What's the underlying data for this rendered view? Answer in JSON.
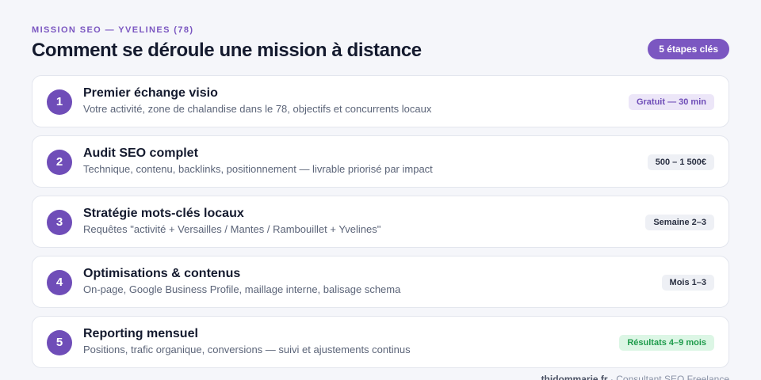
{
  "header": {
    "eyebrow": "MISSION SEO — YVELINES (78)",
    "title": "Comment se déroule une mission à distance",
    "steps_badge": "5 étapes clés"
  },
  "steps": [
    {
      "number": "1",
      "title": "Premier échange visio",
      "description": "Votre activité, zone de chalandise dans le 78, objectifs et concurrents locaux",
      "badge": "Gratuit — 30 min",
      "badge_style": "purple"
    },
    {
      "number": "2",
      "title": "Audit SEO complet",
      "description": "Technique, contenu, backlinks, positionnement — livrable priorisé par impact",
      "badge": "500 – 1 500€",
      "badge_style": "gray"
    },
    {
      "number": "3",
      "title": "Stratégie mots-clés locaux",
      "description": "Requêtes \"activité + Versailles / Mantes / Rambouillet + Yvelines\"",
      "badge": "Semaine 2–3",
      "badge_style": "gray"
    },
    {
      "number": "4",
      "title": "Optimisations & contenus",
      "description": "On-page, Google Business Profile, maillage interne, balisage schema",
      "badge": "Mois 1–3",
      "badge_style": "gray"
    },
    {
      "number": "5",
      "title": "Reporting mensuel",
      "description": "Positions, trafic organique, conversions — suivi et ajustements continus",
      "badge": "Résultats 4–9 mois",
      "badge_style": "green"
    }
  ],
  "footer": {
    "brand": "thidommarie.fr",
    "separator": " · ",
    "role": "Consultant SEO Freelance"
  },
  "colors": {
    "accent": "#7b57c1",
    "number_circle": "#6f4db8",
    "green_badge": "#1f9c4c"
  }
}
